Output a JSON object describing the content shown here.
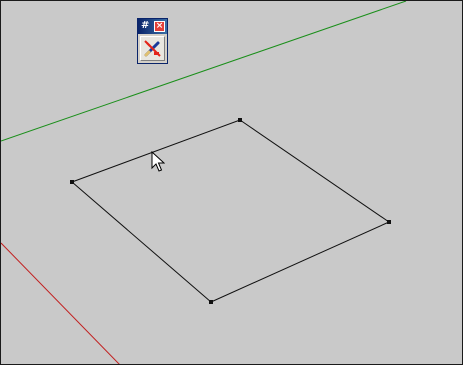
{
  "window": {
    "type": "3d-modeling-viewport",
    "background_color": "#c9c9c9"
  },
  "axes": {
    "green_axis_color": "#1a8f1a",
    "red_axis_color": "#c21f1f"
  },
  "shape": {
    "type": "rectangle",
    "stroke_color": "#111111",
    "vertex_count": 4
  },
  "mini_toolbar": {
    "title_glyph": "#",
    "close_icon": "close-icon",
    "tool_icon": "eraser-pencil-icon"
  },
  "cursor": {
    "icon": "arrow-cursor-icon"
  }
}
